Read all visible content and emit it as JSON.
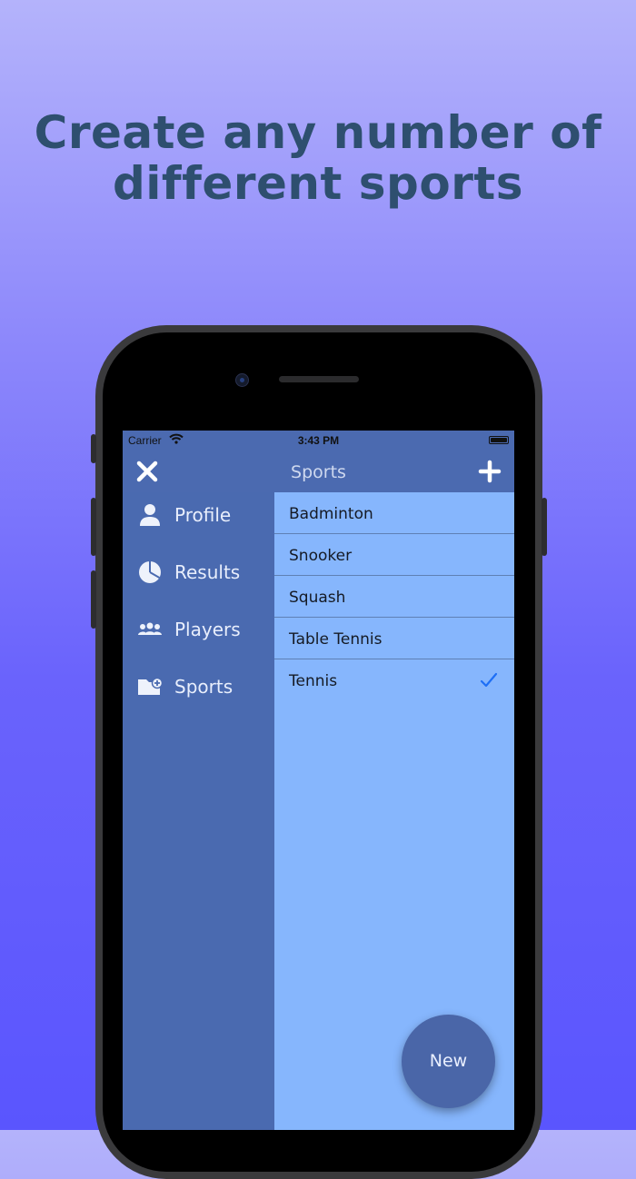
{
  "headline": {
    "line1": "Create any number of",
    "line2": "different sports"
  },
  "statusbar": {
    "carrier": "Carrier",
    "time": "3:43 PM"
  },
  "navbar": {
    "title": "Sports",
    "close_icon": "close-icon",
    "add_icon": "plus-icon"
  },
  "drawer": {
    "items": [
      {
        "label": "Profile",
        "icon": "person-icon"
      },
      {
        "label": "Results",
        "icon": "pie-chart-icon"
      },
      {
        "label": "Players",
        "icon": "group-icon"
      },
      {
        "label": "Sports",
        "icon": "folder-add-icon"
      }
    ]
  },
  "sports": {
    "items": [
      {
        "label": "Badminton",
        "selected": false
      },
      {
        "label": "Snooker",
        "selected": false
      },
      {
        "label": "Squash",
        "selected": false
      },
      {
        "label": "Table Tennis",
        "selected": false
      },
      {
        "label": "Tennis",
        "selected": true
      }
    ]
  },
  "fab": {
    "label": "New"
  },
  "colors": {
    "accent": "#1e6ff5",
    "nav": "#4b6ab0",
    "list_bg": "#86b6fd",
    "headline": "#2e4f6f"
  }
}
